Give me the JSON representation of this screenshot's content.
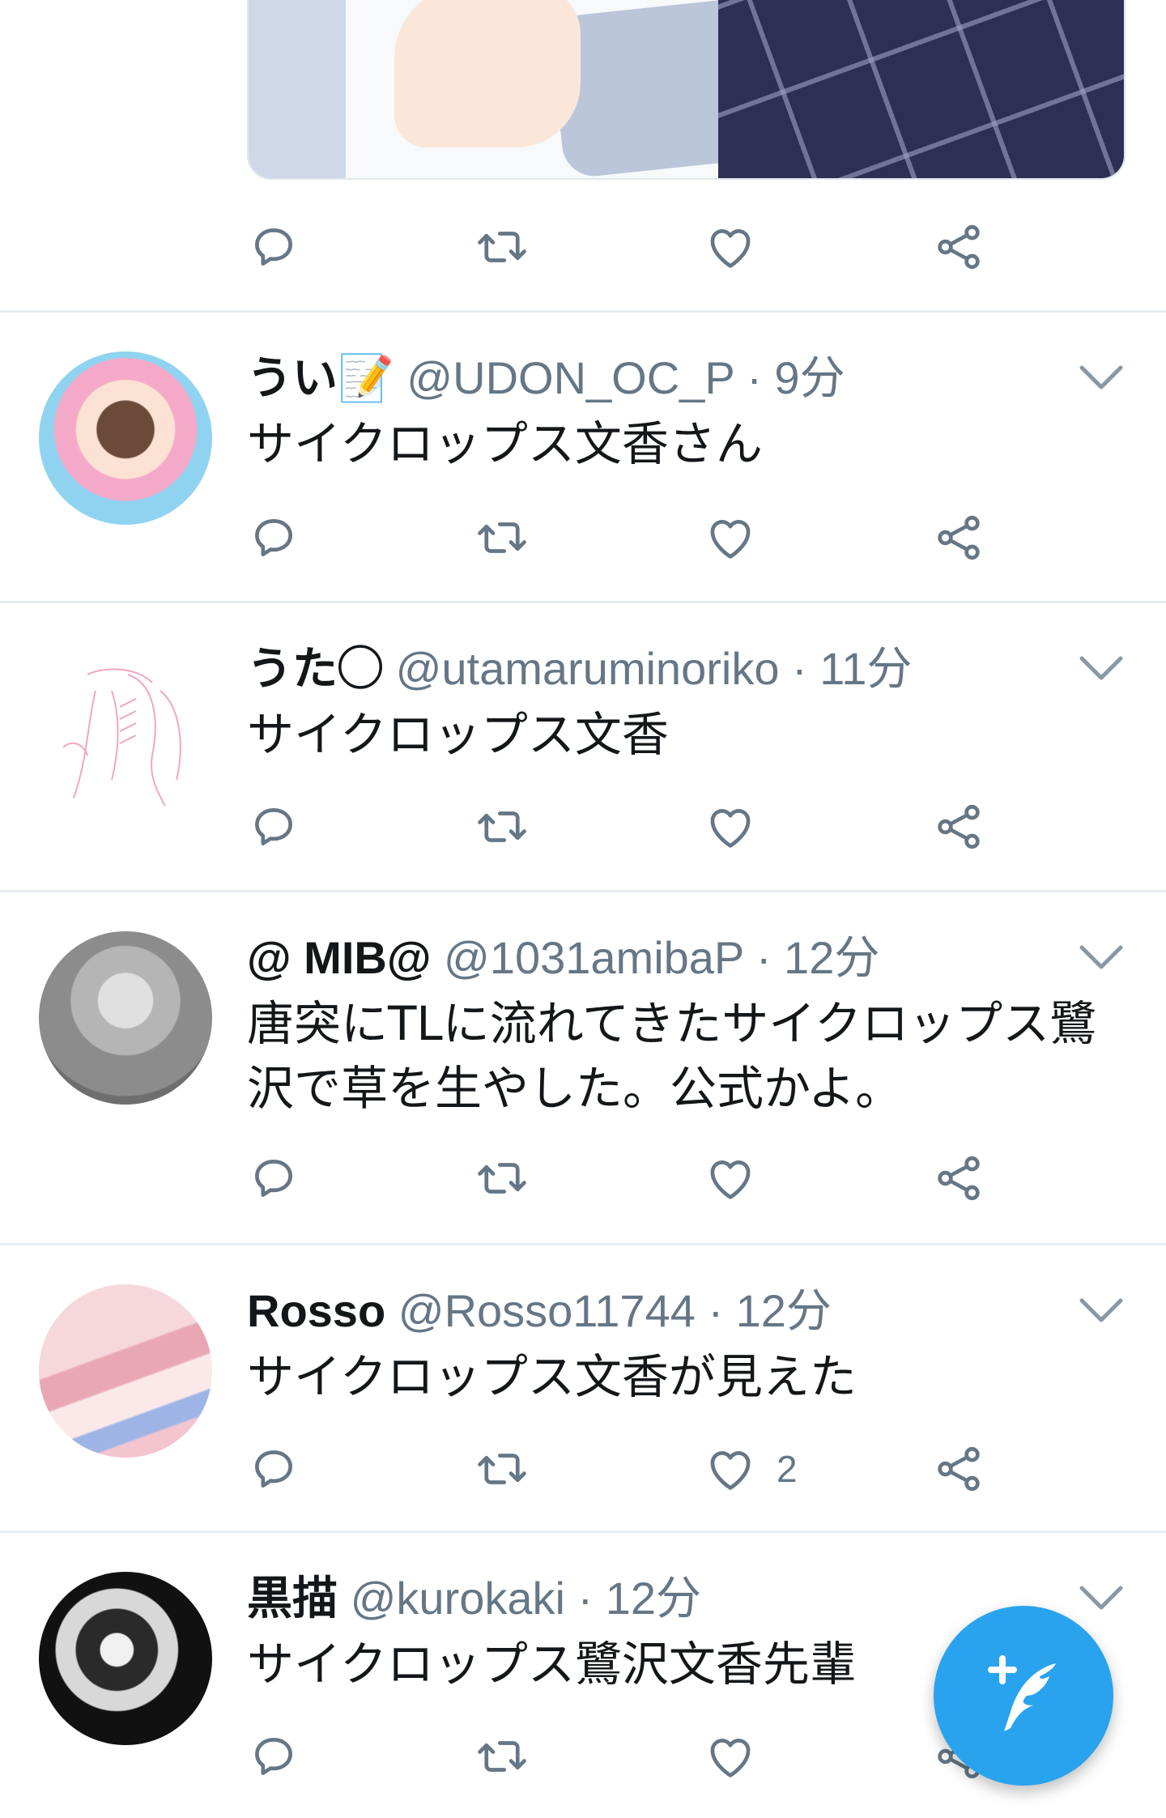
{
  "colors": {
    "accent": "#1da1f2",
    "icon_gray": "#657786",
    "divider": "#e6ecf0",
    "fab": "#2aa3ef"
  },
  "icons": {
    "reply": "reply-icon",
    "retweet": "retweet-icon",
    "like": "heart-icon",
    "share": "share-icon",
    "more": "chevron-down-icon",
    "compose": "compose-tweet-icon"
  },
  "tweets": [
    {
      "name": "うい📝",
      "handle": "@UDON_OC_P",
      "time": "· 9分",
      "text": "サイクロップス文香さん",
      "likes": ""
    },
    {
      "name": "うた◯",
      "handle": "@utamaruminoriko",
      "time": "· 11分",
      "text": "サイクロップス文香",
      "likes": ""
    },
    {
      "name": "@ MIB@",
      "handle": "@1031amibaP",
      "time": "· 12分",
      "text_line1": "唐突にTLに流れてきたサイクロップス鷺",
      "text_line2": "沢で草を生やした。公式かよ。",
      "likes": ""
    },
    {
      "name": "Rosso",
      "handle": "@Rosso11744",
      "time": "· 12分",
      "text": "サイクロップス文香が見えた",
      "likes": "2"
    },
    {
      "name": "黒描",
      "handle": "@kurokaki",
      "time": "· 12分",
      "text": "サイクロップス鷺沢文香先輩",
      "likes": ""
    }
  ]
}
